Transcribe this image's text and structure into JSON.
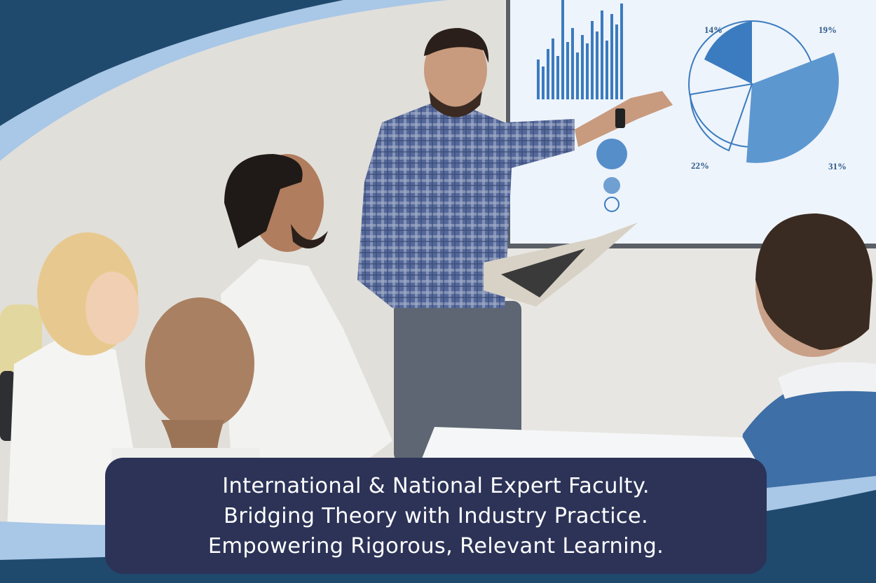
{
  "banner": {
    "caption_lines": [
      "International & National Expert Faculty.",
      "Bridging Theory with Industry Practice.",
      "Empowering Rigorous, Relevant Learning."
    ]
  },
  "screen_chart": {
    "labels": [
      "14%",
      "19%",
      "22%",
      "31%"
    ]
  },
  "colors": {
    "navy": "#1f4a6e",
    "light_blue": "#a9c7e6",
    "caption_bg": "#2c3357",
    "chart_blue": "#3b7bbf"
  }
}
